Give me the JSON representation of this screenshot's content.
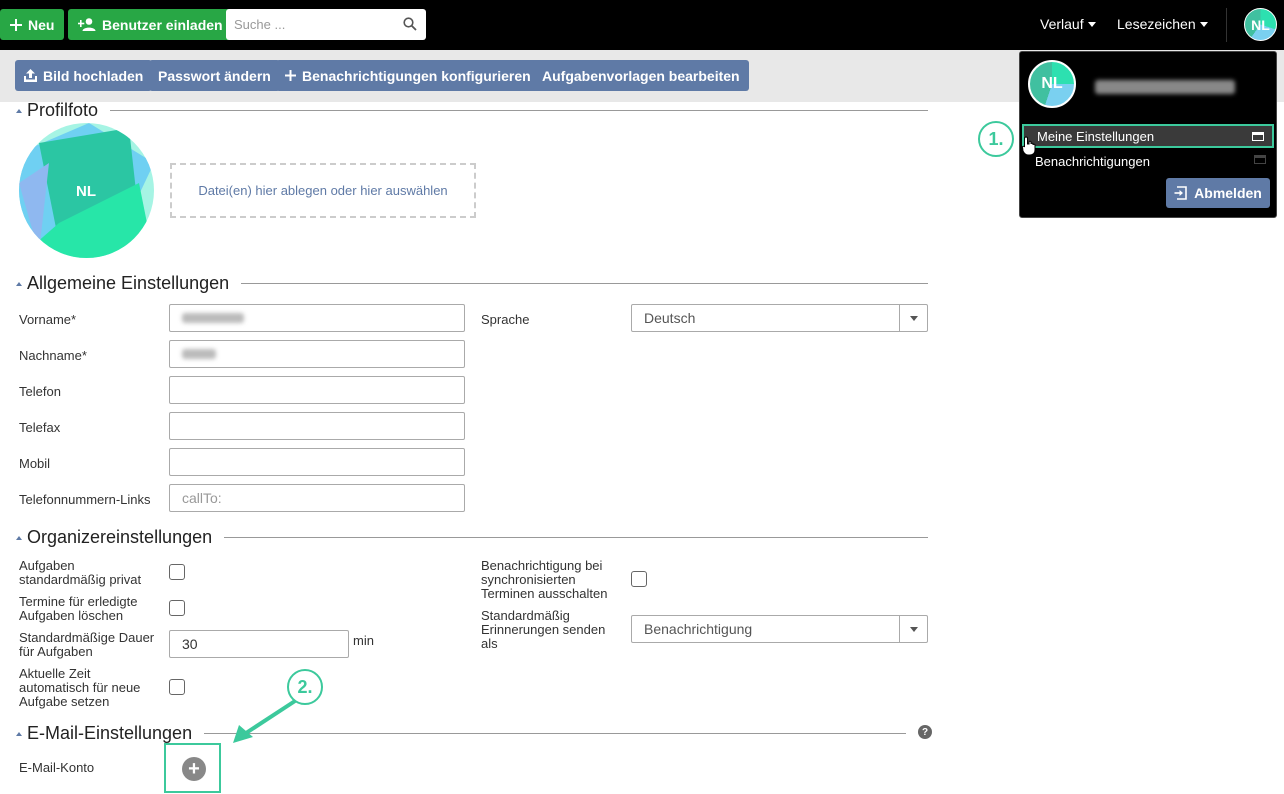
{
  "topbar": {
    "new_label": "Neu",
    "invite_label": "Benutzer einladen",
    "search_placeholder": "Suche ...",
    "history_label": "Verlauf",
    "bookmarks_label": "Lesezeichen",
    "avatar_initials": "NL"
  },
  "toolbar": {
    "upload_label": "Bild hochladen",
    "password_label": "Passwort ändern",
    "notifications_label": "Benachrichtigungen konfigurieren",
    "templates_label": "Aufgabenvorlagen bearbeiten"
  },
  "profile_photo": {
    "title": "Profilfoto",
    "initials": "NL",
    "dropzone_text": "Datei(en) hier ablegen oder hier auswählen"
  },
  "general": {
    "title": "Allgemeine Einstellungen",
    "firstname_label": "Vorname*",
    "lastname_label": "Nachname*",
    "phone_label": "Telefon",
    "fax_label": "Telefax",
    "mobile_label": "Mobil",
    "phone_links_label": "Telefonnummern-Links",
    "phone_links_placeholder": "callTo:",
    "language_label": "Sprache",
    "language_value": "Deutsch"
  },
  "organizer": {
    "title": "Organizereinstellungen",
    "private_label_1": "Aufgaben",
    "private_label_2": "standardmäßig privat",
    "delete_label_1": "Termine für erledigte",
    "delete_label_2": "Aufgaben löschen",
    "duration_label_1": "Standardmäßige Dauer",
    "duration_label_2": "für Aufgaben",
    "duration_value": "30",
    "duration_unit": "min",
    "time_label_1": "Aktuelle Zeit",
    "time_label_2": "automatisch für neue",
    "time_label_3": "Aufgabe setzen",
    "sync_label_1": "Benachrichtigung bei",
    "sync_label_2": "synchronisierten",
    "sync_label_3": "Terminen ausschalten",
    "reminder_label_1": "Standardmäßig",
    "reminder_label_2": "Erinnerungen senden",
    "reminder_label_3": "als",
    "reminder_value": "Benachrichtigung"
  },
  "email": {
    "title": "E-Mail-Einstellungen",
    "account_label": "E-Mail-Konto",
    "help_symbol": "?",
    "add_symbol": "+"
  },
  "user_menu": {
    "initials": "NL",
    "my_settings_label": "Meine Einstellungen",
    "notifications_label": "Benachrichtigungen",
    "logout_label": "Abmelden"
  },
  "annotations": {
    "step1": "1.",
    "step2": "2.",
    "accent_color": "#3cc99c"
  }
}
